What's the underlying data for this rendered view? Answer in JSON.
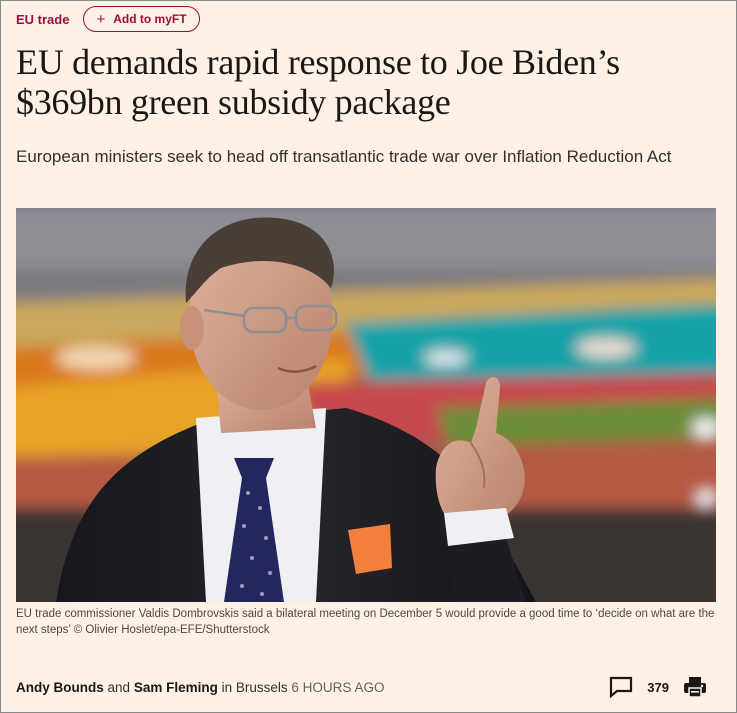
{
  "topic": {
    "label": "EU trade"
  },
  "myft": {
    "plus": "+",
    "label": "Add to myFT"
  },
  "article": {
    "headline": "EU demands rapid response to Joe Biden’s $369bn green subsidy package",
    "standfirst": "European ministers seek to head off transatlantic trade war over Inflation Reduction Act",
    "caption": "EU trade commissioner Valdis Dombrovskis said a bilateral meeting on December 5 would provide a good time to ‘decide on what are the next steps’ © Olivier Hoslet/epa-EFE/Shutterstock"
  },
  "byline": {
    "author1": "Andy Bounds",
    "and": "and",
    "author2": "Sam Fleming",
    "in": "in",
    "location": "Brussels",
    "time": "6 HOURS AGO"
  },
  "actions": {
    "comment_icon": "comment-icon",
    "comment_count": "379",
    "print_icon": "printer-icon"
  },
  "colors": {
    "background": "#fff1e5",
    "accent": "#990f3d",
    "text": "#33302e"
  }
}
